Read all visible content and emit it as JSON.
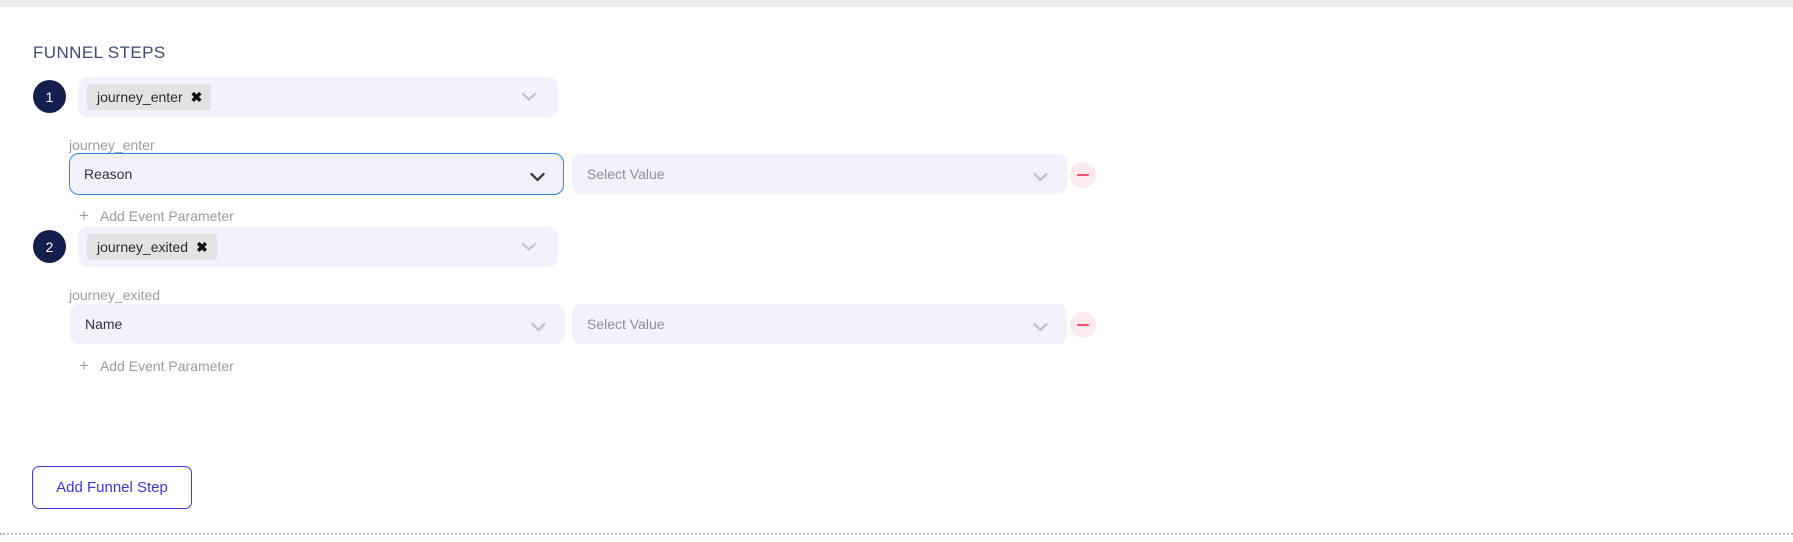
{
  "section": {
    "title": "FUNNEL STEPS"
  },
  "steps": [
    {
      "number": "1",
      "event_chip": "journey_enter",
      "chip_remove_glyph": "✖",
      "param_label": "journey_enter",
      "param_name_value": "Reason",
      "param_value_placeholder": "Select Value",
      "add_param_label": "Add Event Parameter",
      "add_param_glyph": "+",
      "name_select_focused": true
    },
    {
      "number": "2",
      "event_chip": "journey_exited",
      "chip_remove_glyph": "✖",
      "param_label": "journey_exited",
      "param_name_value": "Name",
      "param_value_placeholder": "Select Value",
      "add_param_label": "Add Event Parameter",
      "add_param_glyph": "+",
      "name_select_focused": false
    }
  ],
  "footer": {
    "add_funnel_step_label": "Add Funnel Step"
  },
  "colors": {
    "badge_bg": "#141f4e",
    "field_bg": "#f3f1fc",
    "focus_border": "#2a87f0",
    "accent_button": "#3b35e0",
    "remove_circle_bg": "#fdeaee",
    "remove_bar": "#f2506a",
    "title_text": "#3c4b77",
    "muted_text": "#9a9aa6",
    "chip_bg": "#e3e3e3"
  }
}
